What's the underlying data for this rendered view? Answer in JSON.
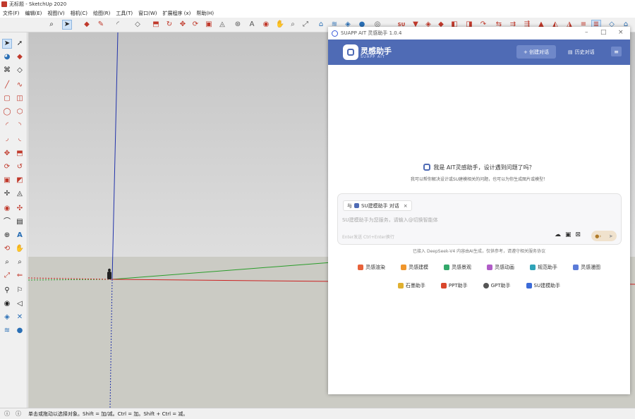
{
  "app": {
    "title": "无标题 - SketchUp 2020",
    "menu": [
      "文件(F)",
      "编辑(E)",
      "视图(V)",
      "相机(C)",
      "绘图(R)",
      "工具(T)",
      "窗口(W)",
      "扩展程序 (x)",
      "帮助(H)"
    ],
    "status_text": "单击或拖动以选择对象。Shift = 加/减。Ctrl = 加。Shift + Ctrl = 减。"
  },
  "panel": {
    "window_title": "SUAPP AIT 灵感助手 1.0.4",
    "brand_name": "灵感助手",
    "brand_sub": "SUAPP AIT",
    "new_chat_label": "+ 创建对话",
    "history_label": "历史对话",
    "greeting": "我是 AIT灵感助手，设计遇到问题了吗？",
    "sub_greeting": "我可以帮你解决设计或SU建模相关的问题，也可以为你生成图片或模型！",
    "input_tag_prefix": "与",
    "input_tag": "SU建模助手 对话",
    "input_placeholder": "SU建模助手为您服务，请输入@切换智能体",
    "input_hint": "Enter发送   Ctrl+Enter换行",
    "powered_by": "已接入 DeepSeek-V4   内容由AI生成，仅供参考，请遵守相关服务协议",
    "assistants_row1": [
      "灵感渲染",
      "灵感建模",
      "灵感景观",
      "灵感动画",
      "规范助手",
      "灵感漫图"
    ],
    "assistants_row2": [
      "石墨助手",
      "PPT助手",
      "GPT助手",
      "SU建模助手"
    ]
  },
  "colors": {
    "header": "#4f6bb5",
    "axis_blue": "#2233aa",
    "axis_green": "#2a9d2a",
    "axis_red": "#cc2222"
  }
}
